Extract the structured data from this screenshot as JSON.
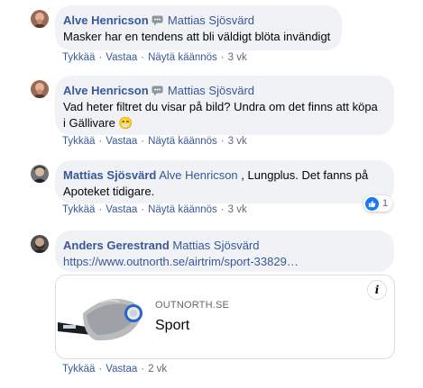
{
  "comments": [
    {
      "author": "Alve Henricson",
      "reply_to": "Mattias Sjösvärd",
      "text": "Masker har en tendens att bli väldigt blöta invändigt",
      "actions": [
        "Tykkää",
        "Vastaa",
        "Näytä käännös"
      ],
      "time": "3 vk"
    },
    {
      "author": "Alve Henricson",
      "reply_to": "Mattias Sjösvärd",
      "text_line1": "Vad heter filtret du visar på bild? Undra om det finns att köpa",
      "text_line2": "i Gällivare 😁",
      "actions": [
        "Tykkää",
        "Vastaa",
        "Näytä käännös"
      ],
      "time": "3 vk"
    },
    {
      "author": "Mattias Sjösvärd",
      "reply_to": "Alve Henricson",
      "text_line1": ", Lungplus. Det fanns på",
      "text_line2": "Apoteket tidigare.",
      "reaction_count": "1",
      "actions": [
        "Tykkää",
        "Vastaa",
        "Näytä käännös"
      ],
      "time": "3 vk"
    },
    {
      "author": "Anders Gerestrand",
      "reply_to": "Mattias Sjösvärd",
      "link_text": "https://www.outnorth.se/airtrim/sport-33829…",
      "card_domain": "OUTNORTH.SE",
      "card_title": "Sport",
      "card_info": "i",
      "actions": [
        "Tykkää",
        "Vastaa"
      ],
      "time": "2 vk"
    }
  ],
  "colors": {
    "link": "#385898",
    "bubble": "#f0f2f5",
    "meta": "#65676b",
    "like": "#1877f2"
  },
  "icons": {
    "reply_indicator": "speech-bubble-icon",
    "reaction": "thumbs-up-icon",
    "info": "info-icon"
  }
}
